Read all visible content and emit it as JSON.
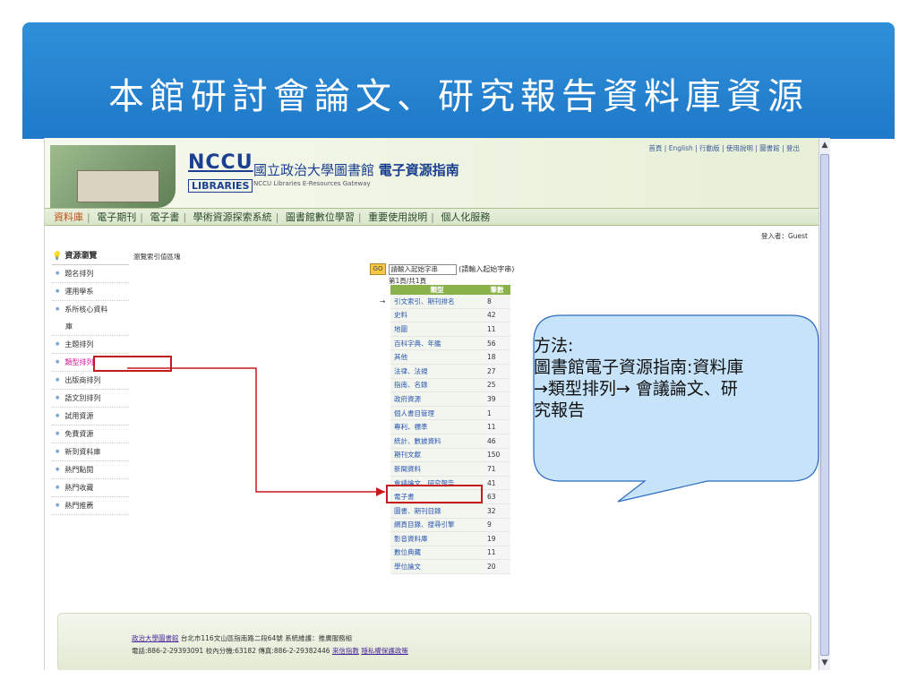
{
  "slide": {
    "title": "本館研討會論文、研究報告資料庫資源"
  },
  "header": {
    "logo_text": "NCCU",
    "logo_sub": "LIBRARIES",
    "site_title_plain": "國立政治大學圖書館",
    "site_title_bold": "電子資源指南",
    "site_subtitle": "NCCU Libraries E-Resources Gateway",
    "top_links": [
      "首頁",
      "English",
      "行動版",
      "使用說明",
      "圖書館",
      "登出"
    ]
  },
  "nav": {
    "items": [
      "資料庫",
      "電子期刊",
      "電子書",
      "學術資源探索系統",
      "圖書館數位學習",
      "重要使用說明",
      "個人化服務"
    ],
    "active_index": 0
  },
  "login_status": "登入者：Guest",
  "sidebar": {
    "heading": "資源瀏覽",
    "items": [
      {
        "label": "題名排列"
      },
      {
        "label": "運用學系"
      },
      {
        "label": "系所核心資料"
      },
      {
        "label": "庫"
      },
      {
        "label": "主題排列"
      },
      {
        "label": "類型排列"
      },
      {
        "label": "出版商排列"
      },
      {
        "label": "語文別排列"
      },
      {
        "label": "試用資源"
      },
      {
        "label": "免費資源"
      },
      {
        "label": "新到資料庫"
      },
      {
        "label": "熱門點閱"
      },
      {
        "label": "熱門收藏"
      },
      {
        "label": "熱門推薦"
      }
    ]
  },
  "browse_label": "瀏覽索引值區塊",
  "search": {
    "go_label": "GO",
    "input_value": "請輸入起始字串",
    "hint": "(請輸入起始字串)"
  },
  "page_info": "第1頁/共1頁",
  "table": {
    "headers": [
      "類型",
      "筆數"
    ],
    "rows": [
      {
        "name": "引文索引、期刊排名",
        "count": "8"
      },
      {
        "name": "史料",
        "count": "42"
      },
      {
        "name": "地圖",
        "count": "11"
      },
      {
        "name": "百科字典、年鑑",
        "count": "56"
      },
      {
        "name": "其他",
        "count": "18"
      },
      {
        "name": "法律、法規",
        "count": "27"
      },
      {
        "name": "指南、名錄",
        "count": "25"
      },
      {
        "name": "政府資源",
        "count": "39"
      },
      {
        "name": "個人書目管理",
        "count": "1"
      },
      {
        "name": "專利、標準",
        "count": "11"
      },
      {
        "name": "統計、數據資料",
        "count": "46"
      },
      {
        "name": "期刊文獻",
        "count": "150"
      },
      {
        "name": "新聞資料",
        "count": "71"
      },
      {
        "name": "會議論文、研究報告",
        "count": "41"
      },
      {
        "name": "電子書",
        "count": "63"
      },
      {
        "name": "圖書、期刊目錄",
        "count": "32"
      },
      {
        "name": "網頁目錄、搜尋引擎",
        "count": "9"
      },
      {
        "name": "影音資料庫",
        "count": "19"
      },
      {
        "name": "數位典藏",
        "count": "11"
      },
      {
        "name": "學位論文",
        "count": "20"
      }
    ]
  },
  "footer": {
    "line1_link": "政治大學圖書館",
    "line1_text": " 台北市116文山區指南路二段64號 系統維護：推廣服務組",
    "line2_text": "電話:886-2-29393091 校內分機:63182 傳真:886-2-29382446 ",
    "line2_link1": "來信指教",
    "line2_link2": "隱私權保護政策"
  },
  "callout": {
    "lines": [
      "方法:",
      "圖書館電子資源指南:資料庫",
      "→類型排列→ 會議論文、研",
      "究報告"
    ]
  },
  "colors": {
    "title_band": "#2f8fd8",
    "highlight": "#c81a1a",
    "callout_fill": "#c7e3fa",
    "callout_stroke": "#2b6cc0"
  }
}
